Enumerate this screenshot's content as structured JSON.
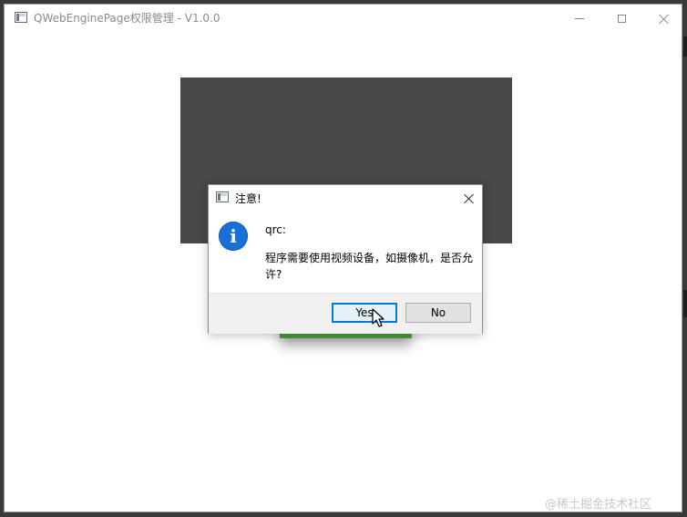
{
  "window": {
    "title": "QWebEnginePage权限管理 - V1.0.0",
    "icon": "app-window-icon",
    "controls": [
      "minimize-icon",
      "maximize-icon",
      "close-icon"
    ]
  },
  "dialog": {
    "title": "注意!",
    "icon": "information-icon",
    "info_glyph": "i",
    "heading": "qrc:",
    "message": "程序需要使用视频设备，如摄像机，是否允许?",
    "buttons": {
      "yes": "Yes",
      "no": "No"
    },
    "default_button": "Yes"
  },
  "watermark": "@稀土掘金技术社区",
  "colors": {
    "info_icon": "#1a6fd6",
    "video_area": "#484848",
    "green_strip": "#4a9a3e",
    "default_button_border": "#0078d7"
  }
}
